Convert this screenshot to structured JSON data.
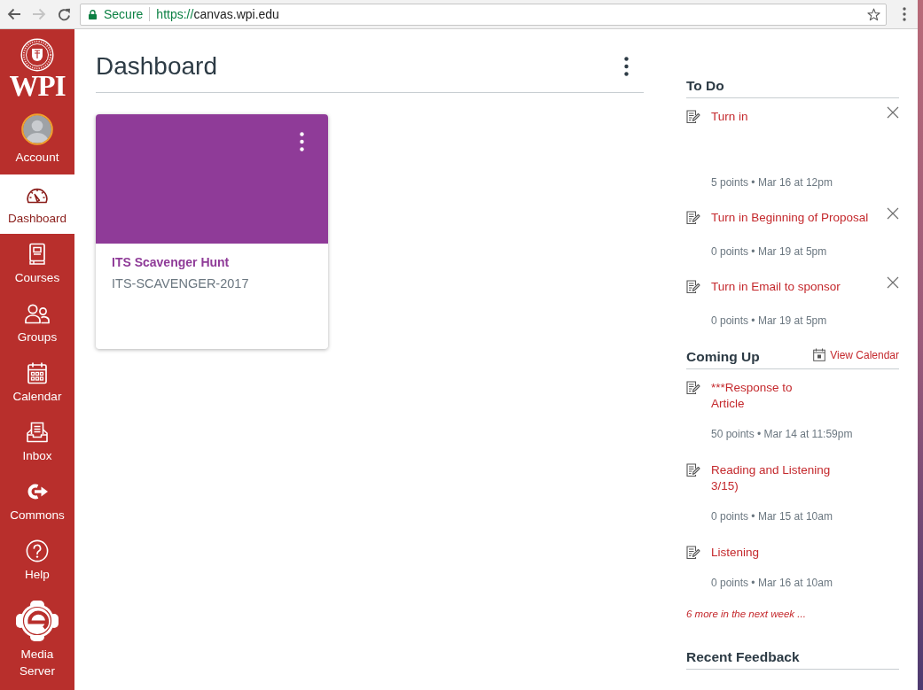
{
  "browser": {
    "nav_buttons": [
      {
        "kind": "back",
        "disabled": false
      },
      {
        "kind": "forward",
        "disabled": true
      },
      {
        "kind": "reload",
        "disabled": false
      }
    ],
    "security_label": "Secure",
    "url_scheme": "https://",
    "url_host": "canvas.wpi.edu"
  },
  "nav": {
    "logo_text": "WPI",
    "account": {
      "label": "Account"
    },
    "items": [
      {
        "kind": "dashboard",
        "label": "Dashboard",
        "selected": true
      },
      {
        "kind": "courses",
        "label": "Courses",
        "selected": false
      },
      {
        "kind": "groups",
        "label": "Groups",
        "selected": false
      },
      {
        "kind": "calendar",
        "label": "Calendar",
        "selected": false
      },
      {
        "kind": "inbox",
        "label": "Inbox",
        "selected": false
      },
      {
        "kind": "commons",
        "label": "Commons",
        "selected": false
      },
      {
        "kind": "help",
        "label": "Help",
        "selected": false
      },
      {
        "kind": "media",
        "label": "Media Server",
        "selected": false
      }
    ]
  },
  "main": {
    "title": "Dashboard",
    "cards": [
      {
        "title": "ITS Scavenger Hunt",
        "code": "ITS-SCAVENGER-2017",
        "color": "#8f3b98"
      }
    ]
  },
  "sidebar": {
    "todo": {
      "title": "To Do",
      "items": [
        {
          "title": "Turn in",
          "meta": "5 points • Mar 16 at 12pm"
        },
        {
          "title": "Turn in Beginning of Proposal",
          "meta": "0 points • Mar 19 at 5pm"
        },
        {
          "title": "Turn in Email to sponsor",
          "meta": "0 points • Mar 19 at 5pm"
        }
      ]
    },
    "coming_up": {
      "title": "Coming Up",
      "calendar_link": "View Calendar",
      "items": [
        {
          "title_lines": [
            "***Response to",
            "Article"
          ],
          "meta": "50 points • Mar 14 at 11:59pm"
        },
        {
          "title_lines": [
            "Reading and Listening",
            "3/15)"
          ],
          "meta": "0 points • Mar 15 at 10am"
        },
        {
          "title_lines": [
            "Listening"
          ],
          "meta": "0 points • Mar 16 at 10am"
        }
      ],
      "more_link": "6 more in the next week ..."
    },
    "recent_feedback": {
      "title": "Recent Feedback"
    }
  }
}
